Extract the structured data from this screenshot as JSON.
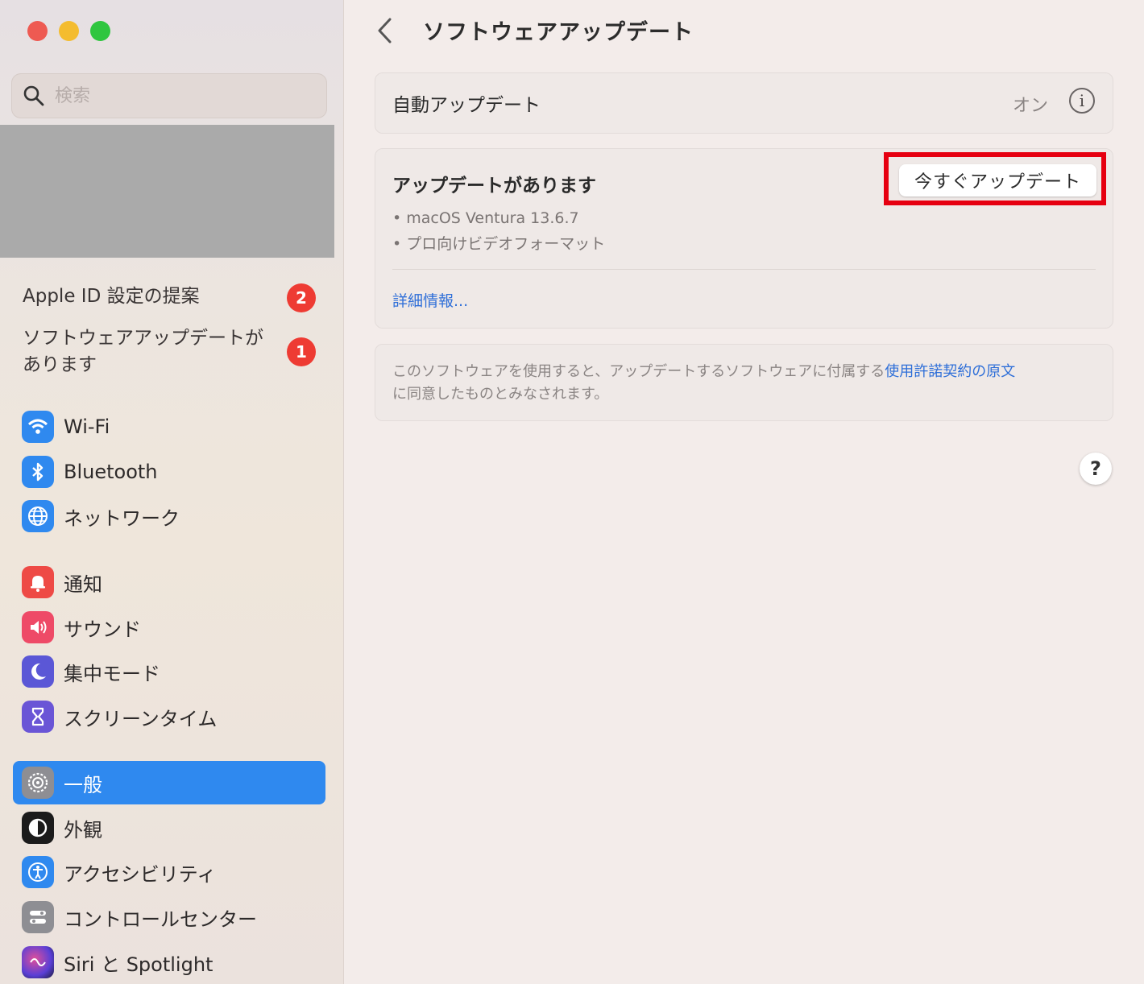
{
  "window": {
    "title": "ソフトウェアアップデート"
  },
  "sidebar": {
    "search_placeholder": "検索",
    "suggestions": [
      {
        "label": "Apple ID 設定の提案",
        "badge": "2"
      },
      {
        "label": "ソフトウェアアップデートがあります",
        "badge": "1"
      }
    ],
    "groups": [
      [
        {
          "label": "Wi-Fi",
          "icon": "wifi-icon",
          "color": "#2f89ef"
        },
        {
          "label": "Bluetooth",
          "icon": "bluetooth-icon",
          "color": "#2f89ef"
        },
        {
          "label": "ネットワーク",
          "icon": "globe-icon",
          "color": "#2f89ef"
        }
      ],
      [
        {
          "label": "通知",
          "icon": "bell-icon",
          "color": "#ee4a45"
        },
        {
          "label": "サウンド",
          "icon": "speaker-icon",
          "color": "#ee4a67"
        },
        {
          "label": "集中モード",
          "icon": "moon-icon",
          "color": "#5b57d6"
        },
        {
          "label": "スクリーンタイム",
          "icon": "hourglass-icon",
          "color": "#6a55d6"
        }
      ],
      [
        {
          "label": "一般",
          "icon": "gear-icon",
          "color": "#8e8e93",
          "active": true
        },
        {
          "label": "外観",
          "icon": "appearance-icon",
          "color": "#1b1b1b"
        },
        {
          "label": "アクセシビリティ",
          "icon": "accessibility-icon",
          "color": "#2f89ef"
        },
        {
          "label": "コントロールセンター",
          "icon": "control-center-icon",
          "color": "#8e8e93"
        },
        {
          "label": "Siri と Spotlight",
          "icon": "siri-icon",
          "color": "#6a4fd8"
        }
      ]
    ]
  },
  "main": {
    "auto_update": {
      "label": "自動アップデート",
      "value": "オン"
    },
    "updates": {
      "heading": "アップデートがあります",
      "items": [
        "• macOS Ventura 13.6.7",
        "• プロ向けビデオフォーマット"
      ],
      "button": "今すぐアップデート",
      "more_info": "詳細情報..."
    },
    "license": {
      "text_before": "このソフトウェアを使用すると、アップデートするソフトウェアに付属する",
      "link": "使用許諾契約の原文",
      "text_after": "に同意したものとみなされます。"
    },
    "help": "?"
  },
  "colors": {
    "accent": "#2f89ef",
    "badge": "#ee3b33",
    "highlight": "#e60011",
    "link": "#2f6fd8"
  }
}
